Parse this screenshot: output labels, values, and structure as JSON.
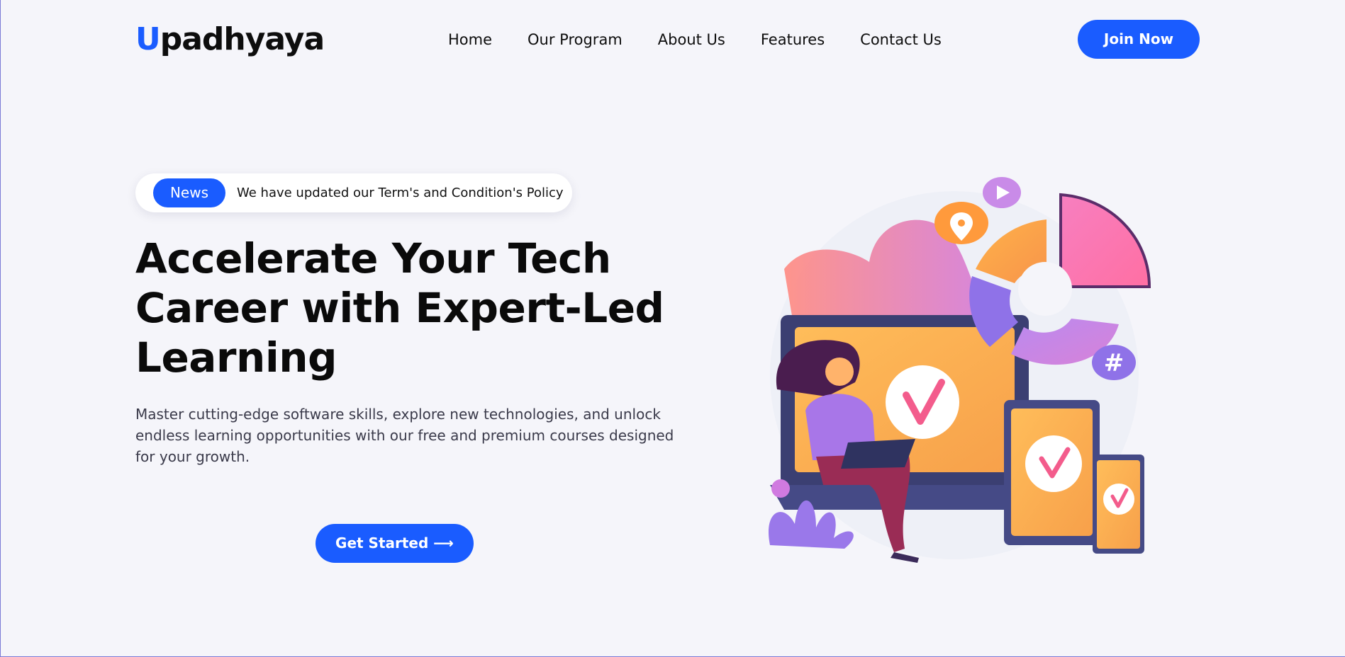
{
  "brand": {
    "logo_first": "U",
    "logo_rest": "padhyaya",
    "accent_color": "#1a5cff"
  },
  "nav": {
    "items": [
      {
        "label": "Home"
      },
      {
        "label": "Our Program"
      },
      {
        "label": "About Us"
      },
      {
        "label": "Features"
      },
      {
        "label": "Contact Us"
      }
    ],
    "join_label": "Join Now"
  },
  "hero": {
    "news_badge": "News",
    "news_text": "We have updated our Term's and Condition's Policy",
    "headline": "Accelerate Your Tech Career with Expert-Led Learning",
    "subtext": "Master cutting-edge software skills, explore new technologies, and unlock endless learning opportunities with our free and premium courses designed for your growth.",
    "cta_label": "Get Started ⟶"
  },
  "illustration": {
    "icons": [
      "play-icon",
      "location-pin-icon",
      "hashtag-icon",
      "checkmark-icon"
    ],
    "hashtag": "#"
  }
}
